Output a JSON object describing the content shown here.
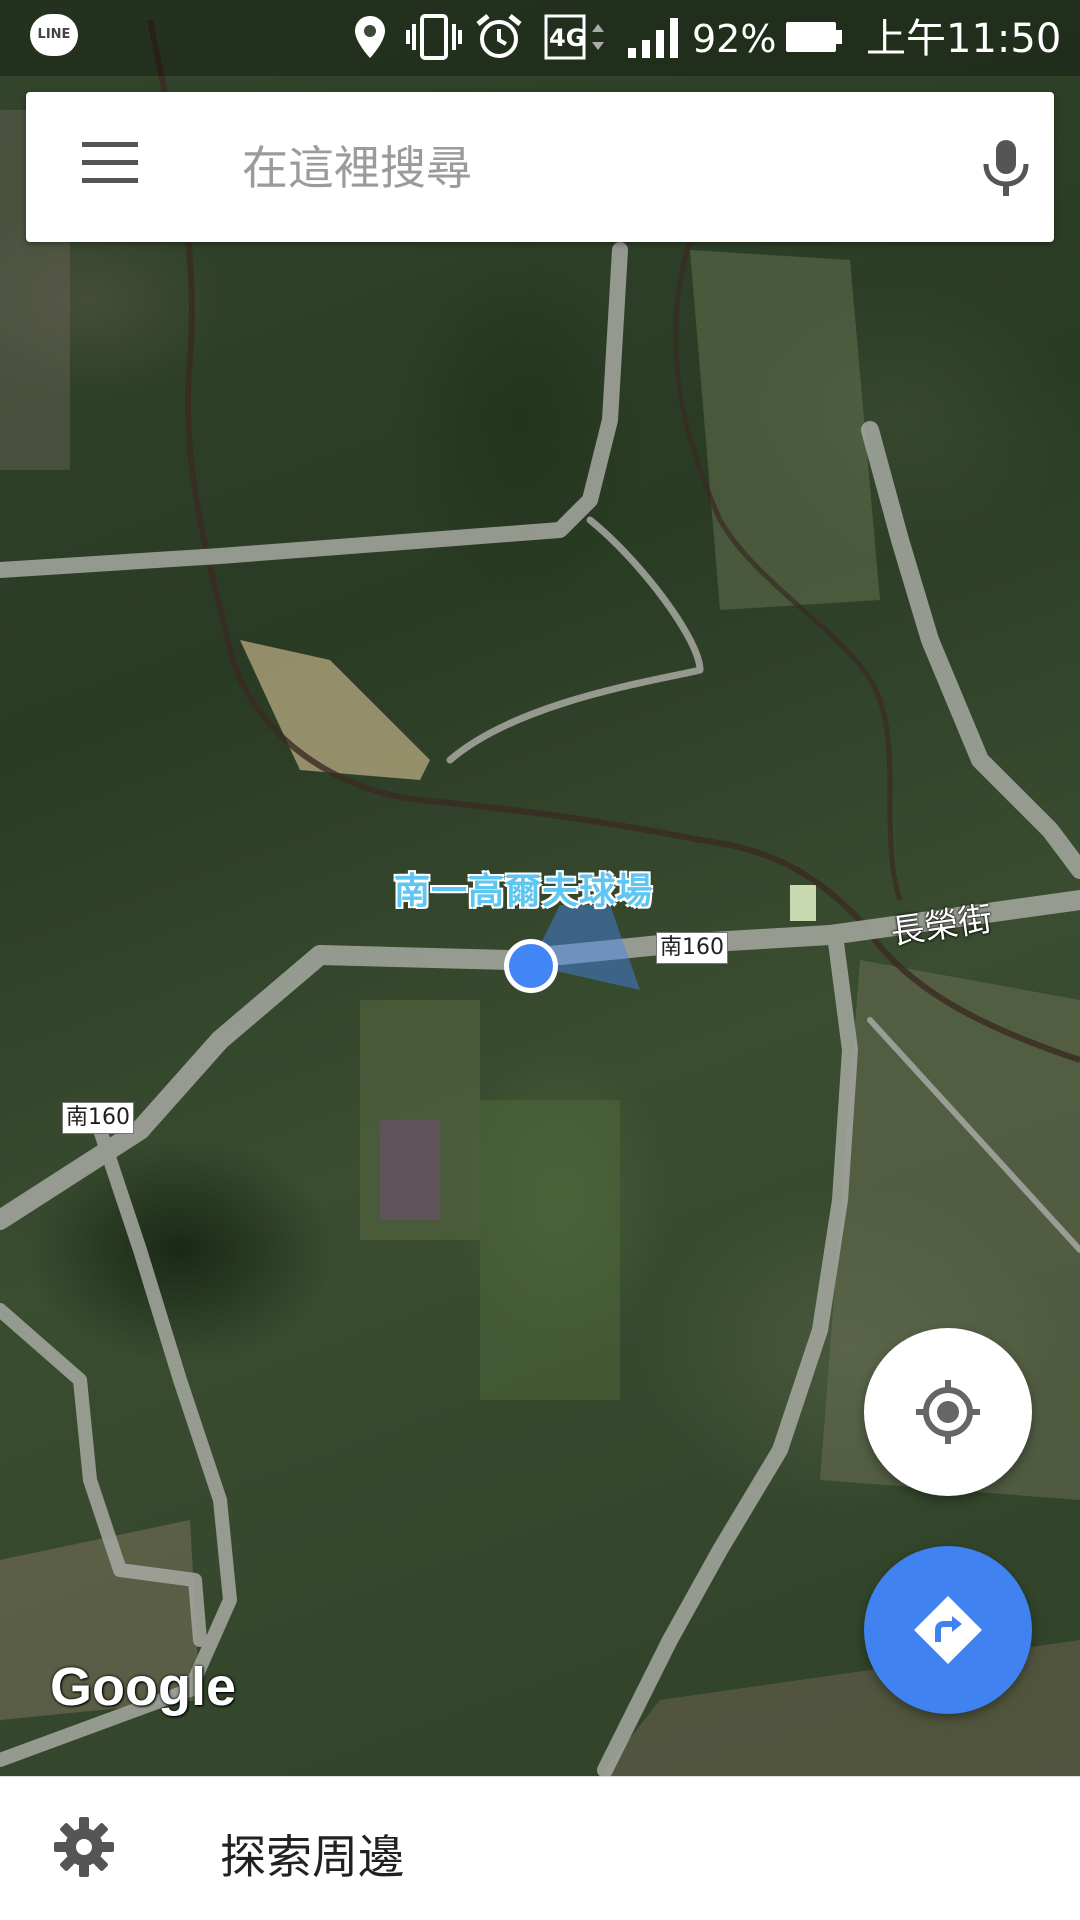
{
  "status_bar": {
    "app_icon": "LINE",
    "icons": [
      "location-pin-icon",
      "vibrate-icon",
      "alarm-icon",
      "4g-icon",
      "signal-icon",
      "battery-icon"
    ],
    "network": "4G",
    "battery": "92%",
    "time": "上午11:50"
  },
  "search": {
    "placeholder": "在這裡搜尋",
    "value": ""
  },
  "map": {
    "type": "satellite",
    "place_label": "南一高爾夫球場",
    "street_label": "長榮街",
    "road_shields": [
      "南160",
      "南160"
    ],
    "attribution": "Google",
    "user_location_color": "#4285f4"
  },
  "buttons": {
    "my_location": "my-location-icon",
    "directions": "directions-icon"
  },
  "bottom_bar": {
    "explore_label": "探索周邊",
    "icon": "gear-icon"
  },
  "colors": {
    "accent_blue": "#3f82f0",
    "status_text": "#ffffff"
  }
}
